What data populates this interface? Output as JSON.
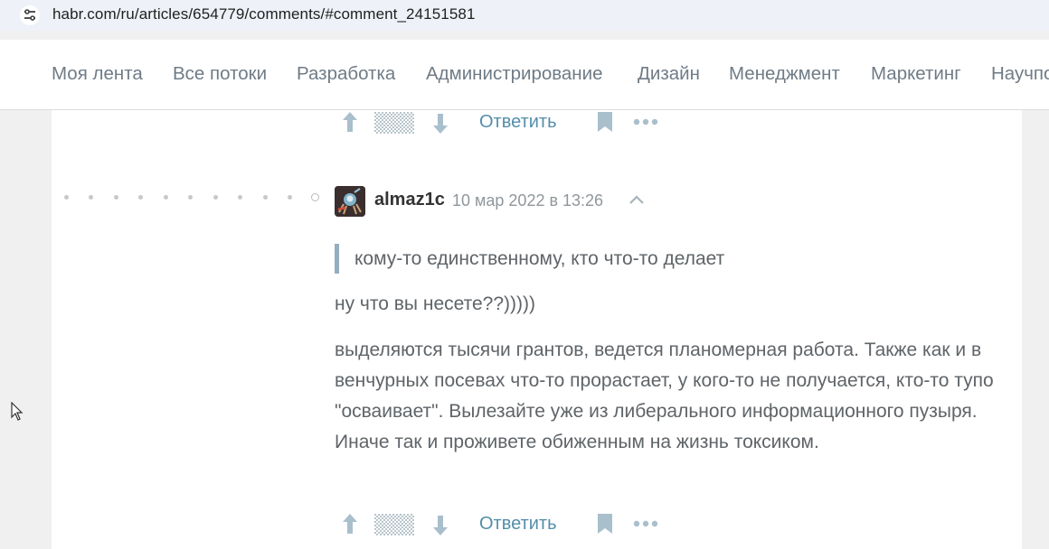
{
  "browser": {
    "url": "habr.com/ru/articles/654779/comments/#comment_24151581",
    "site_info_icon": "tune-icon"
  },
  "nav": {
    "items": [
      "Моя лента",
      "Все потоки",
      "Разработка",
      "Администрирование",
      "Дизайн",
      "Менеджмент",
      "Маркетинг",
      "Научпоп"
    ]
  },
  "previous_comment": {
    "actions": {
      "reply_label": "Ответить",
      "icons": [
        "arrow-up-icon",
        "score-pattern-icon",
        "arrow-down-icon",
        "bookmark-icon",
        "more-icon"
      ]
    }
  },
  "comment": {
    "username": "almaz1c",
    "date": "10 мар 2022 в 13:26",
    "quote": "кому-то единственному, кто что-то делает",
    "paragraphs": [
      "ну что вы несете??)))))",
      "выделяются тысячи грантов, ведется планомерная работа. Также как и в венчурных посевах что-то прорастает, у кого-то не получается, кто-то тупо \"осваивает\". Вылезайте уже из либерального информационного пузыря. Иначе так и проживете обиженным на жизнь токсиком."
    ],
    "actions": {
      "reply_label": "Ответить"
    }
  },
  "colors": {
    "accent_link": "#548eaa",
    "quote_bar": "#94aec0",
    "text": "#5f6468",
    "muted": "#8f979c"
  }
}
